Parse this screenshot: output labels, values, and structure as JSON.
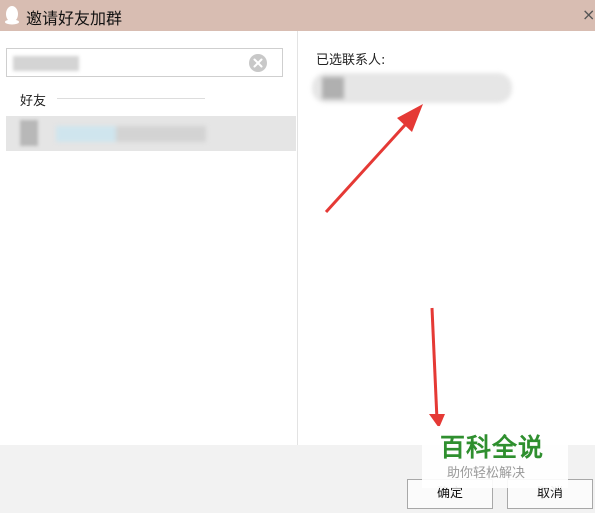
{
  "window": {
    "title": "邀请好友加群",
    "close_glyph": "×"
  },
  "left_pane": {
    "search": {
      "value": ""
    },
    "group_label": "好友",
    "friends": [
      {
        "name": ""
      }
    ]
  },
  "right_pane": {
    "selected_label": "已选联系人:",
    "selected": [
      {
        "name": ""
      }
    ]
  },
  "buttons": {
    "ok_label": "确定",
    "cancel_label": "取消"
  },
  "watermark": {
    "title": "百科全说",
    "subtitle": "助你轻松解决"
  },
  "colors": {
    "titlebar": "#d8bdb2",
    "arrow": "#e53935",
    "watermark_green": "#2f8f2f"
  }
}
